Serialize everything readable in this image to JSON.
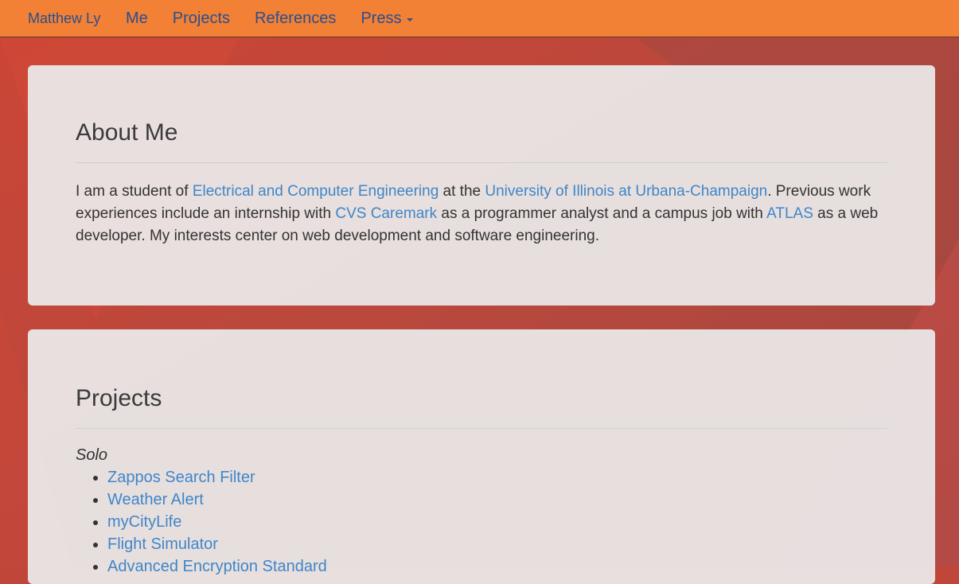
{
  "navbar": {
    "brand": "Matthew Ly",
    "links": [
      "Me",
      "Projects",
      "References",
      "Press"
    ]
  },
  "about": {
    "heading": "About Me",
    "t1": "I am a student of ",
    "link_ece": "Electrical and Computer Engineering",
    "t2": " at the ",
    "link_uiuc": "University of Illinois at Urbana-Champaign",
    "t3": ". Previous work experiences include an internship with ",
    "link_cvs": "CVS Caremark",
    "t4": " as a programmer analyst and a campus job with ",
    "link_atlas": "ATLAS",
    "t5": " as a web developer. My interests center on web development and software engineering."
  },
  "projects": {
    "heading": "Projects",
    "group": "Solo",
    "items": [
      "Zappos Search Filter",
      "Weather Alert",
      "myCityLife",
      "Flight Simulator",
      "Advanced Encryption Standard"
    ]
  },
  "colors": {
    "navbar": "#f28035",
    "background": "#c0463a",
    "link": "#3f86c9",
    "nav_text": "#2a4f8f"
  }
}
